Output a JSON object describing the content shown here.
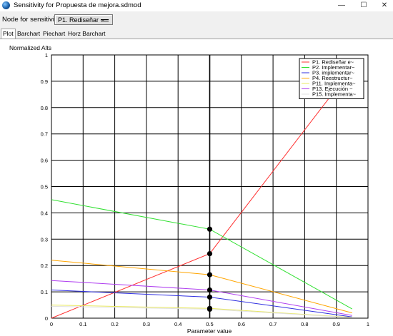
{
  "window": {
    "title": "Sensitivity for Propuesta de mejora.sdmod",
    "minimize_glyph": "—",
    "maximize_glyph": "☐",
    "close_glyph": "✕"
  },
  "toolbar": {
    "node_label": "Node for sensitivity:",
    "node_value": "P1. Rediseñar ~"
  },
  "tabs": [
    {
      "label": "Plot",
      "active": true
    },
    {
      "label": "Barchart",
      "active": false
    },
    {
      "label": "Piechart",
      "active": false
    },
    {
      "label": "Horz Barchart",
      "active": false
    }
  ],
  "chart_data": {
    "type": "line",
    "ylabel": "Normalized Alts",
    "xlabel": "Parameter value",
    "xlim": [
      0,
      1
    ],
    "ylim": [
      0,
      1
    ],
    "xticks": [
      "0",
      "0.1",
      "0.2",
      "0.3",
      "0.4",
      "0.5",
      "0.6",
      "0.7",
      "0.8",
      "0.9",
      "1"
    ],
    "yticks": [
      "0",
      "0.1",
      "0.2",
      "0.3",
      "0.4",
      "0.5",
      "0.6",
      "0.7",
      "0.8",
      "0.9",
      "1"
    ],
    "grid": true,
    "legend_position": "top-right",
    "marker_x": 0.5,
    "series": [
      {
        "name": "P1. Rediseñar e~",
        "color": "#ff3030",
        "points": [
          [
            0,
            0
          ],
          [
            0.5,
            0.245
          ],
          [
            0.95,
            0.95
          ]
        ]
      },
      {
        "name": "P2. Implementar~",
        "color": "#30e030",
        "points": [
          [
            0,
            0.45
          ],
          [
            0.5,
            0.338
          ],
          [
            0.95,
            0.035
          ]
        ]
      },
      {
        "name": "P3. implementar~",
        "color": "#3030e0",
        "points": [
          [
            0,
            0.107
          ],
          [
            0.5,
            0.08
          ],
          [
            0.95,
            0.005
          ]
        ]
      },
      {
        "name": "P4. Reestructur~",
        "color": "#ffa500",
        "points": [
          [
            0,
            0.22
          ],
          [
            0.5,
            0.165
          ],
          [
            0.95,
            0.02
          ]
        ]
      },
      {
        "name": "P11. Implementa~",
        "color": "#e8e860",
        "points": [
          [
            0,
            0.05
          ],
          [
            0.5,
            0.037
          ],
          [
            0.95,
            0.003
          ]
        ]
      },
      {
        "name": "P13. Ejecución ~",
        "color": "#b040f0",
        "points": [
          [
            0,
            0.143
          ],
          [
            0.5,
            0.107
          ],
          [
            0.95,
            0.01
          ]
        ]
      },
      {
        "name": "P15. Implementa~",
        "color": "#e0e0e0",
        "points": [
          [
            0,
            0.045
          ],
          [
            0.5,
            0.034
          ],
          [
            0.95,
            0.002
          ]
        ]
      }
    ]
  }
}
